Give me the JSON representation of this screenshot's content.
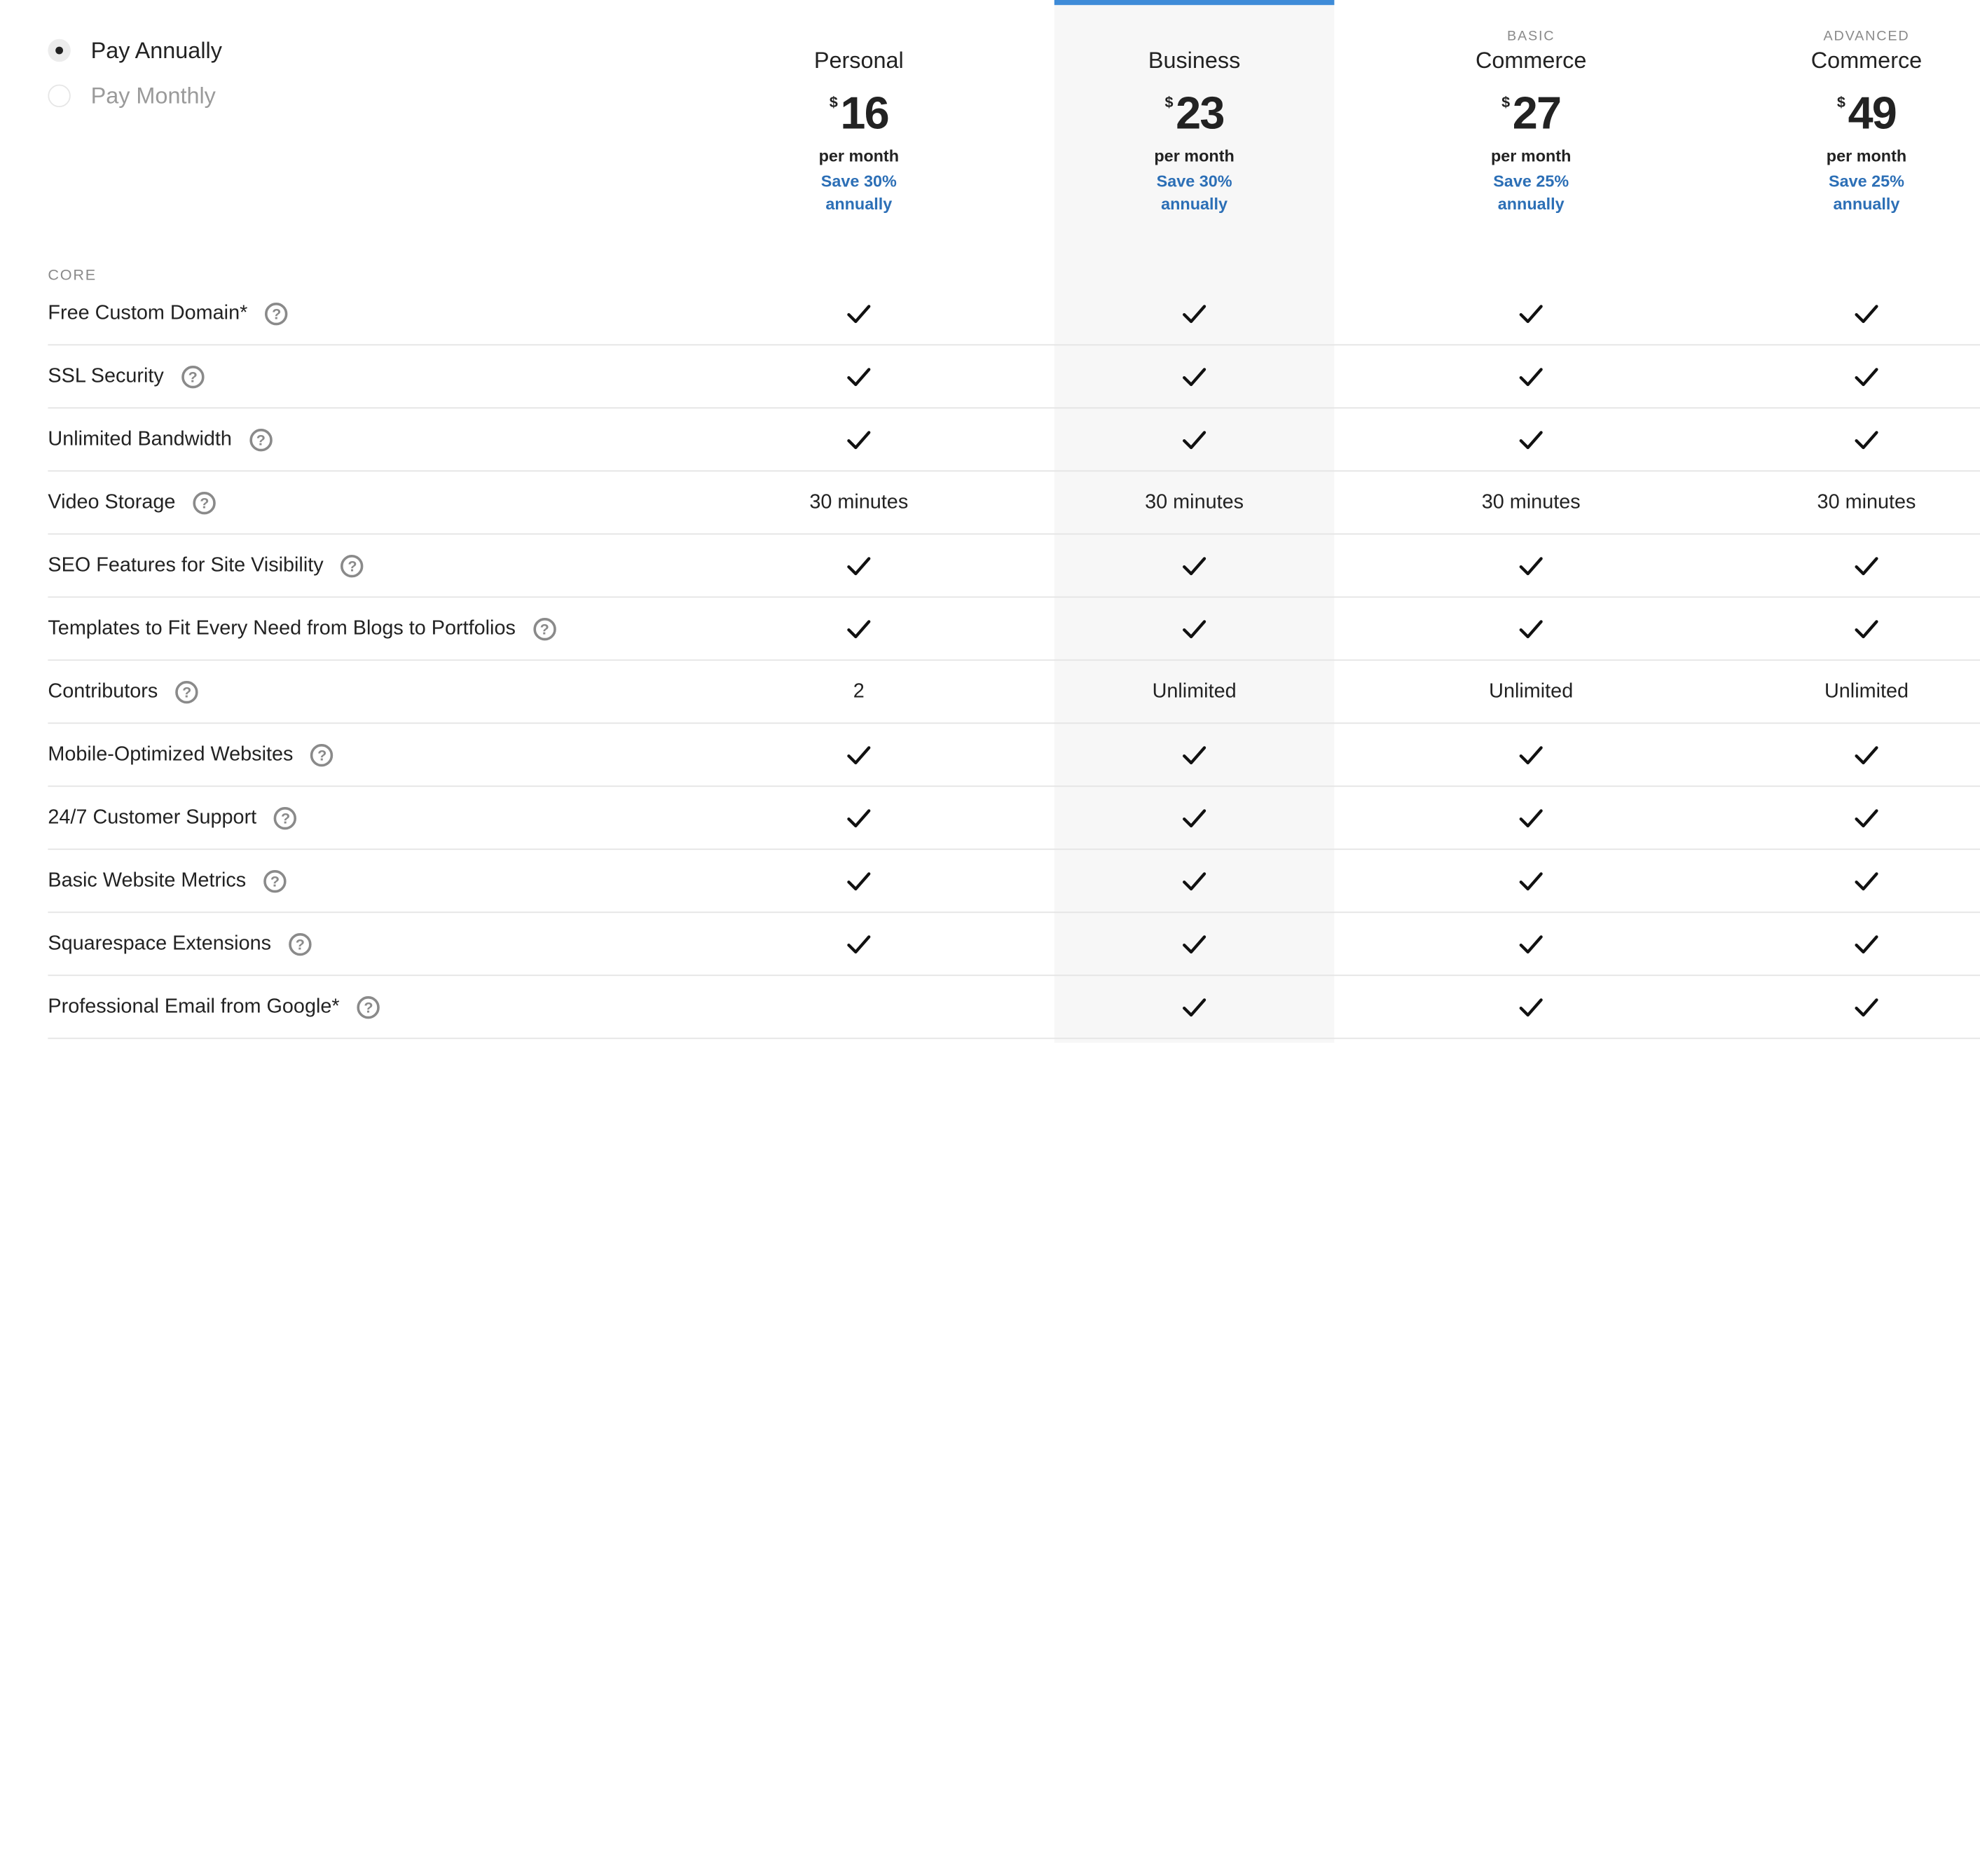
{
  "billing": [
    {
      "label": "Pay Annually",
      "selected": true
    },
    {
      "label": "Pay Monthly",
      "selected": false
    }
  ],
  "plans": [
    {
      "tier": "",
      "name": "Personal",
      "currency": "$",
      "price": "16",
      "per": "per month",
      "save_line1": "Save 30%",
      "save_line2": "annually",
      "highlighted": false
    },
    {
      "tier": "",
      "name": "Business",
      "currency": "$",
      "price": "23",
      "per": "per month",
      "save_line1": "Save 30%",
      "save_line2": "annually",
      "highlighted": true
    },
    {
      "tier": "BASIC",
      "name": "Commerce",
      "currency": "$",
      "price": "27",
      "per": "per month",
      "save_line1": "Save 25%",
      "save_line2": "annually",
      "highlighted": false
    },
    {
      "tier": "ADVANCED",
      "name": "Commerce",
      "currency": "$",
      "price": "49",
      "per": "per month",
      "save_line1": "Save 25%",
      "save_line2": "annually",
      "highlighted": false
    }
  ],
  "section": "CORE",
  "help_icon": "question-circle-icon",
  "check_icon": "checkmark-icon",
  "colors": {
    "accent": "#3e8bd8",
    "save_text": "#2c6fb6",
    "highlight_bg": "#f7f7f7"
  },
  "features": [
    {
      "name": "Free Custom Domain*",
      "values": [
        "check",
        "check",
        "check",
        "check"
      ]
    },
    {
      "name": "SSL Security",
      "values": [
        "check",
        "check",
        "check",
        "check"
      ]
    },
    {
      "name": "Unlimited Bandwidth",
      "values": [
        "check",
        "check",
        "check",
        "check"
      ]
    },
    {
      "name": "Video Storage",
      "values": [
        "30 minutes",
        "30 minutes",
        "30 minutes",
        "30 minutes"
      ]
    },
    {
      "name": "SEO Features for Site Visibility",
      "values": [
        "check",
        "check",
        "check",
        "check"
      ]
    },
    {
      "name": "Templates to Fit Every Need from Blogs to Portfolios",
      "values": [
        "check",
        "check",
        "check",
        "check"
      ]
    },
    {
      "name": "Contributors",
      "values": [
        "2",
        "Unlimited",
        "Unlimited",
        "Unlimited"
      ]
    },
    {
      "name": "Mobile-Optimized Websites",
      "values": [
        "check",
        "check",
        "check",
        "check"
      ]
    },
    {
      "name": "24/7 Customer Support",
      "values": [
        "check",
        "check",
        "check",
        "check"
      ]
    },
    {
      "name": "Basic Website Metrics",
      "values": [
        "check",
        "check",
        "check",
        "check"
      ]
    },
    {
      "name": "Squarespace Extensions",
      "values": [
        "check",
        "check",
        "check",
        "check"
      ]
    },
    {
      "name": "Professional Email from Google*",
      "values": [
        "",
        "check",
        "check",
        "check"
      ]
    }
  ]
}
